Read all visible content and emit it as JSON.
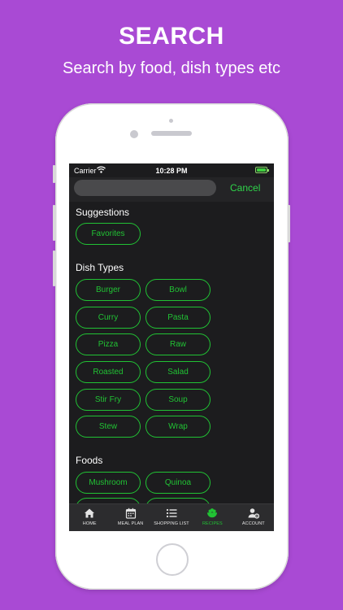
{
  "promo": {
    "title": "SEARCH",
    "subtitle": "Search by food, dish types etc"
  },
  "status_bar": {
    "carrier": "Carrier",
    "time": "10:28 PM"
  },
  "search": {
    "value": "",
    "cancel_label": "Cancel"
  },
  "sections": {
    "suggestions": {
      "title": "Suggestions",
      "items": [
        "Favorites"
      ]
    },
    "dish_types": {
      "title": "Dish Types",
      "items": [
        "Burger",
        "Bowl",
        "Curry",
        "Pasta",
        "Pizza",
        "Raw",
        "Roasted",
        "Salad",
        "Stir Fry",
        "Soup",
        "Stew",
        "Wrap"
      ]
    },
    "foods": {
      "title": "Foods",
      "items": [
        "Mushroom",
        "Quinoa",
        "",
        ""
      ]
    }
  },
  "tab_bar": {
    "items": [
      {
        "label": "HOME",
        "icon": "home-icon"
      },
      {
        "label": "MEAL PLAN",
        "icon": "calendar-icon"
      },
      {
        "label": "SHOPPING LIST",
        "icon": "list-icon"
      },
      {
        "label": "RECIPES",
        "icon": "bowl-icon"
      },
      {
        "label": "ACCOUNT",
        "icon": "account-gear-icon"
      }
    ],
    "active_index": 3
  },
  "colors": {
    "background": "#a94ad4",
    "accent": "#21c234",
    "screen": "#1c1c1e"
  }
}
